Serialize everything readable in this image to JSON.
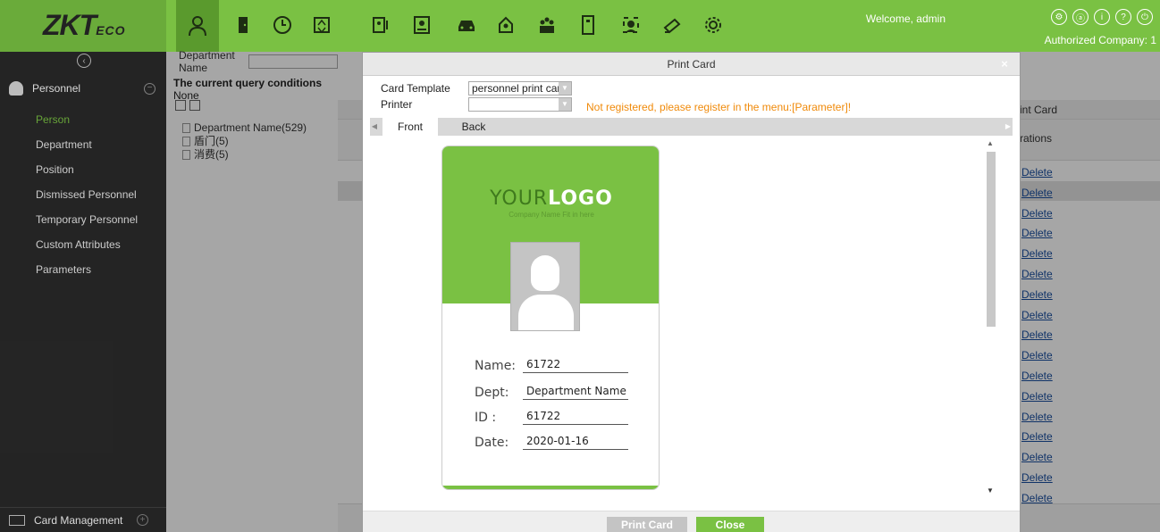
{
  "header": {
    "logo_main": "ZKT",
    "logo_sub": "ECO",
    "welcome": "Welcome, admin",
    "authorized_company": "Authorized Company: 1",
    "accent_color": "#7ac143",
    "module_icons": [
      "person-icon",
      "door-icon",
      "clock-icon",
      "elevator-icon",
      "visitor-icon",
      "id-card-icon",
      "car-icon",
      "patrol-icon",
      "meeting-icon",
      "locker-icon",
      "face-icon",
      "video-icon",
      "system-settings-icon"
    ]
  },
  "sidebar": {
    "collapse_icon": "chevron-left-circle-icon",
    "section_title": "Personnel",
    "items": [
      {
        "label": "Person",
        "active": true
      },
      {
        "label": "Department",
        "active": false
      },
      {
        "label": "Position",
        "active": false
      },
      {
        "label": "Dismissed Personnel",
        "active": false
      },
      {
        "label": "Temporary Personnel",
        "active": false
      },
      {
        "label": "Custom Attributes",
        "active": false
      },
      {
        "label": "Parameters",
        "active": false
      }
    ],
    "footer_label": "Card Management"
  },
  "dept_panel": {
    "search_label": "Department Name",
    "search_value": "",
    "query_prefix": "The current query conditions",
    "query_value": "None",
    "tree": [
      "Department Name(529)",
      "盾门(5)",
      "消费(5)"
    ]
  },
  "grid": {
    "right_title": "int Card",
    "ops_header": "rations",
    "delete_label": "Delete",
    "delete_rows": 17
  },
  "dialog": {
    "title": "Print Card",
    "close_glyph": "×",
    "card_template_label": "Card Template",
    "card_template_value": "personnel print car",
    "printer_label": "Printer",
    "printer_value": "",
    "warning": "Not registered, please register in the menu:[Parameter]!",
    "tabs": [
      "Front",
      "Back"
    ],
    "active_tab": "Front",
    "print_button": "Print Card",
    "close_button": "Close"
  },
  "card": {
    "logo_left": "YOUR",
    "logo_right": "LOGO",
    "logo_sub": "Company Name Fit in here",
    "fields": [
      {
        "label": "Name:",
        "value": "61722"
      },
      {
        "label": "Dept:",
        "value": "Department Name"
      },
      {
        "label": "ID  :",
        "value": "61722"
      },
      {
        "label": "Date:",
        "value": "2020-01-16"
      }
    ]
  }
}
